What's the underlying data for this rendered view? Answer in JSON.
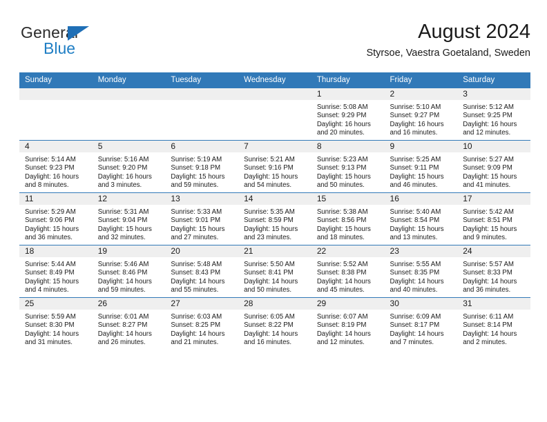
{
  "brand": {
    "word_one": "General",
    "word_two": "Blue",
    "triangle_icon": "triangle-icon",
    "accent_color": "#1f7ec4"
  },
  "header": {
    "title": "August 2024",
    "subtitle": "Styrsoe, Vaestra Goetaland, Sweden"
  },
  "theme": {
    "header_blue": "#3179b8",
    "row_separator_blue": "#3179b8",
    "daynum_band_gray": "#efefef",
    "text_color": "#1a1a1a"
  },
  "weekday_headers": [
    "Sunday",
    "Monday",
    "Tuesday",
    "Wednesday",
    "Thursday",
    "Friday",
    "Saturday"
  ],
  "labels": {
    "sunrise_prefix": "Sunrise:",
    "sunset_prefix": "Sunset:",
    "daylight_prefix": "Daylight:"
  },
  "weeks": [
    [
      {
        "day": "",
        "empty": true,
        "lines": []
      },
      {
        "day": "",
        "empty": true,
        "lines": []
      },
      {
        "day": "",
        "empty": true,
        "lines": []
      },
      {
        "day": "",
        "empty": true,
        "lines": []
      },
      {
        "day": "1",
        "empty": false,
        "lines": [
          "Sunrise: 5:08 AM",
          "Sunset: 9:29 PM",
          "Daylight: 16 hours",
          "and 20 minutes."
        ]
      },
      {
        "day": "2",
        "empty": false,
        "lines": [
          "Sunrise: 5:10 AM",
          "Sunset: 9:27 PM",
          "Daylight: 16 hours",
          "and 16 minutes."
        ]
      },
      {
        "day": "3",
        "empty": false,
        "lines": [
          "Sunrise: 5:12 AM",
          "Sunset: 9:25 PM",
          "Daylight: 16 hours",
          "and 12 minutes."
        ]
      }
    ],
    [
      {
        "day": "4",
        "empty": false,
        "lines": [
          "Sunrise: 5:14 AM",
          "Sunset: 9:23 PM",
          "Daylight: 16 hours",
          "and 8 minutes."
        ]
      },
      {
        "day": "5",
        "empty": false,
        "lines": [
          "Sunrise: 5:16 AM",
          "Sunset: 9:20 PM",
          "Daylight: 16 hours",
          "and 3 minutes."
        ]
      },
      {
        "day": "6",
        "empty": false,
        "lines": [
          "Sunrise: 5:19 AM",
          "Sunset: 9:18 PM",
          "Daylight: 15 hours",
          "and 59 minutes."
        ]
      },
      {
        "day": "7",
        "empty": false,
        "lines": [
          "Sunrise: 5:21 AM",
          "Sunset: 9:16 PM",
          "Daylight: 15 hours",
          "and 54 minutes."
        ]
      },
      {
        "day": "8",
        "empty": false,
        "lines": [
          "Sunrise: 5:23 AM",
          "Sunset: 9:13 PM",
          "Daylight: 15 hours",
          "and 50 minutes."
        ]
      },
      {
        "day": "9",
        "empty": false,
        "lines": [
          "Sunrise: 5:25 AM",
          "Sunset: 9:11 PM",
          "Daylight: 15 hours",
          "and 46 minutes."
        ]
      },
      {
        "day": "10",
        "empty": false,
        "lines": [
          "Sunrise: 5:27 AM",
          "Sunset: 9:09 PM",
          "Daylight: 15 hours",
          "and 41 minutes."
        ]
      }
    ],
    [
      {
        "day": "11",
        "empty": false,
        "lines": [
          "Sunrise: 5:29 AM",
          "Sunset: 9:06 PM",
          "Daylight: 15 hours",
          "and 36 minutes."
        ]
      },
      {
        "day": "12",
        "empty": false,
        "lines": [
          "Sunrise: 5:31 AM",
          "Sunset: 9:04 PM",
          "Daylight: 15 hours",
          "and 32 minutes."
        ]
      },
      {
        "day": "13",
        "empty": false,
        "lines": [
          "Sunrise: 5:33 AM",
          "Sunset: 9:01 PM",
          "Daylight: 15 hours",
          "and 27 minutes."
        ]
      },
      {
        "day": "14",
        "empty": false,
        "lines": [
          "Sunrise: 5:35 AM",
          "Sunset: 8:59 PM",
          "Daylight: 15 hours",
          "and 23 minutes."
        ]
      },
      {
        "day": "15",
        "empty": false,
        "lines": [
          "Sunrise: 5:38 AM",
          "Sunset: 8:56 PM",
          "Daylight: 15 hours",
          "and 18 minutes."
        ]
      },
      {
        "day": "16",
        "empty": false,
        "lines": [
          "Sunrise: 5:40 AM",
          "Sunset: 8:54 PM",
          "Daylight: 15 hours",
          "and 13 minutes."
        ]
      },
      {
        "day": "17",
        "empty": false,
        "lines": [
          "Sunrise: 5:42 AM",
          "Sunset: 8:51 PM",
          "Daylight: 15 hours",
          "and 9 minutes."
        ]
      }
    ],
    [
      {
        "day": "18",
        "empty": false,
        "lines": [
          "Sunrise: 5:44 AM",
          "Sunset: 8:49 PM",
          "Daylight: 15 hours",
          "and 4 minutes."
        ]
      },
      {
        "day": "19",
        "empty": false,
        "lines": [
          "Sunrise: 5:46 AM",
          "Sunset: 8:46 PM",
          "Daylight: 14 hours",
          "and 59 minutes."
        ]
      },
      {
        "day": "20",
        "empty": false,
        "lines": [
          "Sunrise: 5:48 AM",
          "Sunset: 8:43 PM",
          "Daylight: 14 hours",
          "and 55 minutes."
        ]
      },
      {
        "day": "21",
        "empty": false,
        "lines": [
          "Sunrise: 5:50 AM",
          "Sunset: 8:41 PM",
          "Daylight: 14 hours",
          "and 50 minutes."
        ]
      },
      {
        "day": "22",
        "empty": false,
        "lines": [
          "Sunrise: 5:52 AM",
          "Sunset: 8:38 PM",
          "Daylight: 14 hours",
          "and 45 minutes."
        ]
      },
      {
        "day": "23",
        "empty": false,
        "lines": [
          "Sunrise: 5:55 AM",
          "Sunset: 8:35 PM",
          "Daylight: 14 hours",
          "and 40 minutes."
        ]
      },
      {
        "day": "24",
        "empty": false,
        "lines": [
          "Sunrise: 5:57 AM",
          "Sunset: 8:33 PM",
          "Daylight: 14 hours",
          "and 36 minutes."
        ]
      }
    ],
    [
      {
        "day": "25",
        "empty": false,
        "lines": [
          "Sunrise: 5:59 AM",
          "Sunset: 8:30 PM",
          "Daylight: 14 hours",
          "and 31 minutes."
        ]
      },
      {
        "day": "26",
        "empty": false,
        "lines": [
          "Sunrise: 6:01 AM",
          "Sunset: 8:27 PM",
          "Daylight: 14 hours",
          "and 26 minutes."
        ]
      },
      {
        "day": "27",
        "empty": false,
        "lines": [
          "Sunrise: 6:03 AM",
          "Sunset: 8:25 PM",
          "Daylight: 14 hours",
          "and 21 minutes."
        ]
      },
      {
        "day": "28",
        "empty": false,
        "lines": [
          "Sunrise: 6:05 AM",
          "Sunset: 8:22 PM",
          "Daylight: 14 hours",
          "and 16 minutes."
        ]
      },
      {
        "day": "29",
        "empty": false,
        "lines": [
          "Sunrise: 6:07 AM",
          "Sunset: 8:19 PM",
          "Daylight: 14 hours",
          "and 12 minutes."
        ]
      },
      {
        "day": "30",
        "empty": false,
        "lines": [
          "Sunrise: 6:09 AM",
          "Sunset: 8:17 PM",
          "Daylight: 14 hours",
          "and 7 minutes."
        ]
      },
      {
        "day": "31",
        "empty": false,
        "lines": [
          "Sunrise: 6:11 AM",
          "Sunset: 8:14 PM",
          "Daylight: 14 hours",
          "and 2 minutes."
        ]
      }
    ]
  ]
}
